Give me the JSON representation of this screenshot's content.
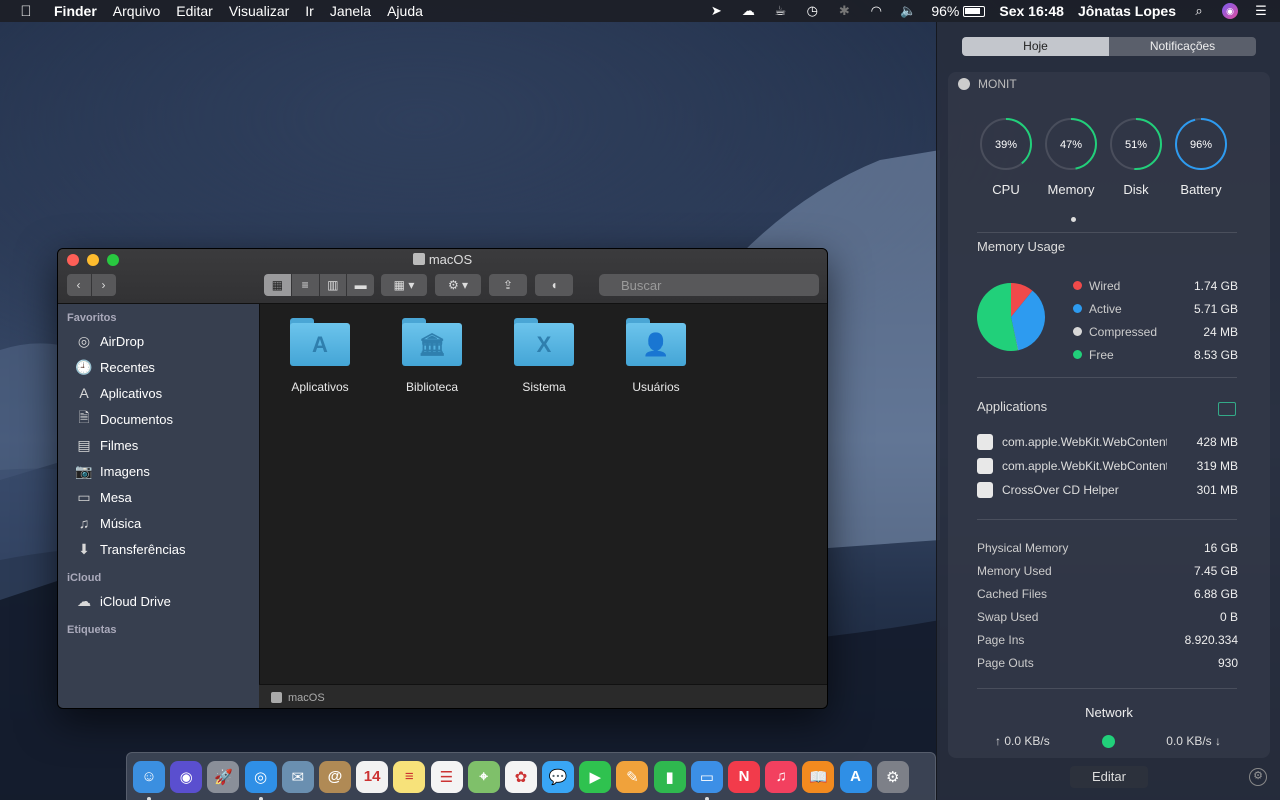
{
  "menubar": {
    "apple_icon": "apple-logo",
    "app_name": "Finder",
    "menus": [
      "Arquivo",
      "Editar",
      "Visualizar",
      "Ir",
      "Janela",
      "Ajuda"
    ],
    "battery": "96%",
    "clock": "Sex 16:48",
    "user": "Jônatas Lopes"
  },
  "finder": {
    "title": "macOS",
    "search_placeholder": "Buscar",
    "sidebar": {
      "favorites_header": "Favoritos",
      "favorites": [
        {
          "label": "AirDrop",
          "icon": "airdrop-icon"
        },
        {
          "label": "Recentes",
          "icon": "clock-icon"
        },
        {
          "label": "Aplicativos",
          "icon": "applications-icon"
        },
        {
          "label": "Documentos",
          "icon": "document-icon"
        },
        {
          "label": "Filmes",
          "icon": "film-icon"
        },
        {
          "label": "Imagens",
          "icon": "camera-icon"
        },
        {
          "label": "Mesa",
          "icon": "desktop-icon"
        },
        {
          "label": "Música",
          "icon": "music-icon"
        },
        {
          "label": "Transferências",
          "icon": "download-icon"
        }
      ],
      "icloud_header": "iCloud",
      "icloud": [
        {
          "label": "iCloud Drive",
          "icon": "cloud-icon"
        }
      ],
      "tags_header": "Etiquetas"
    },
    "items": [
      {
        "name": "Aplicativos",
        "glyph": "A"
      },
      {
        "name": "Biblioteca",
        "glyph": "🏛"
      },
      {
        "name": "Sistema",
        "glyph": "X"
      },
      {
        "name": "Usuários",
        "glyph": "👤"
      }
    ],
    "path_bar": "macOS"
  },
  "notification_center": {
    "tab_today": "Hoje",
    "tab_notifications": "Notificações",
    "widget_title": "MONIT",
    "gauges": [
      {
        "label": "CPU",
        "value": "39%",
        "percent": 39,
        "color": "#21d07a"
      },
      {
        "label": "Memory",
        "value": "47%",
        "percent": 47,
        "color": "#21d07a"
      },
      {
        "label": "Disk",
        "value": "51%",
        "percent": 51,
        "color": "#21d07a"
      },
      {
        "label": "Battery",
        "value": "96%",
        "percent": 96,
        "color": "#2d9bf0"
      }
    ],
    "memory_usage_title": "Memory Usage",
    "memory_breakdown": [
      {
        "label": "Wired",
        "value": "1.74 GB",
        "gb": 1.74,
        "color": "#f04a4a"
      },
      {
        "label": "Active",
        "value": "5.71 GB",
        "gb": 5.71,
        "color": "#2d9bf0"
      },
      {
        "label": "Compressed",
        "value": "24 MB",
        "gb": 0.024,
        "color": "#d8d8d8"
      },
      {
        "label": "Free",
        "value": "8.53 GB",
        "gb": 8.53,
        "color": "#21d07a"
      }
    ],
    "applications_title": "Applications",
    "applications": [
      {
        "name": "com.apple.WebKit.WebContent",
        "value": "428 MB"
      },
      {
        "name": "com.apple.WebKit.WebContent",
        "value": "319 MB"
      },
      {
        "name": "CrossOver CD Helper",
        "value": "301 MB"
      }
    ],
    "stats": [
      {
        "label": "Physical Memory",
        "value": "16 GB"
      },
      {
        "label": "Memory Used",
        "value": "7.45 GB"
      },
      {
        "label": "Cached Files",
        "value": "6.88 GB"
      },
      {
        "label": "Swap Used",
        "value": "0 B"
      },
      {
        "label": "Page Ins",
        "value": "8.920.334"
      },
      {
        "label": "Page Outs",
        "value": "930"
      }
    ],
    "network_title": "Network",
    "upload": "↑ 0.0 KB/s",
    "download": "0.0 KB/s ↓",
    "edit_label": "Editar"
  },
  "dock": {
    "apps": [
      {
        "name": "finder-icon",
        "color": "#3b8fe0",
        "glyph": "☺",
        "running": true
      },
      {
        "name": "siri-icon",
        "color": "#5a4fcf",
        "glyph": "◉",
        "running": false
      },
      {
        "name": "launchpad-icon",
        "color": "#8a8f99",
        "glyph": "🚀",
        "running": false
      },
      {
        "name": "safari-icon",
        "color": "#2f8fe6",
        "glyph": "◎",
        "running": true
      },
      {
        "name": "mail-icon",
        "color": "#6a8fb0",
        "glyph": "✉",
        "running": false
      },
      {
        "name": "contacts-icon",
        "color": "#b08a55",
        "glyph": "@",
        "running": false
      },
      {
        "name": "calendar-icon",
        "color": "#f2f2f2",
        "glyph": "14",
        "running": false
      },
      {
        "name": "notes-icon",
        "color": "#f7e27a",
        "glyph": "≡",
        "running": false
      },
      {
        "name": "reminders-icon",
        "color": "#f4f4f4",
        "glyph": "☰",
        "running": false
      },
      {
        "name": "maps-icon",
        "color": "#7fc06a",
        "glyph": "⌖",
        "running": false
      },
      {
        "name": "photos-icon",
        "color": "#f4f4f4",
        "glyph": "✿",
        "running": false
      },
      {
        "name": "messages-icon",
        "color": "#39a6f5",
        "glyph": "💬",
        "running": false
      },
      {
        "name": "facetime-icon",
        "color": "#2fc24f",
        "glyph": "▶",
        "running": false
      },
      {
        "name": "pages-icon",
        "color": "#f0a23b",
        "glyph": "✎",
        "running": false
      },
      {
        "name": "numbers-icon",
        "color": "#2fb84f",
        "glyph": "▮",
        "running": false
      },
      {
        "name": "keynote-icon",
        "color": "#3c8fe6",
        "glyph": "▭",
        "running": true
      },
      {
        "name": "news-icon",
        "color": "#f23b4b",
        "glyph": "N",
        "running": false
      },
      {
        "name": "music-icon",
        "color": "#f2405f",
        "glyph": "♫",
        "running": false
      },
      {
        "name": "books-icon",
        "color": "#f28a1f",
        "glyph": "📖",
        "running": false
      },
      {
        "name": "app-store-icon",
        "color": "#2f8fe6",
        "glyph": "A",
        "running": false
      },
      {
        "name": "system-preferences-icon",
        "color": "#7d8088",
        "glyph": "⚙",
        "running": false
      }
    ]
  }
}
